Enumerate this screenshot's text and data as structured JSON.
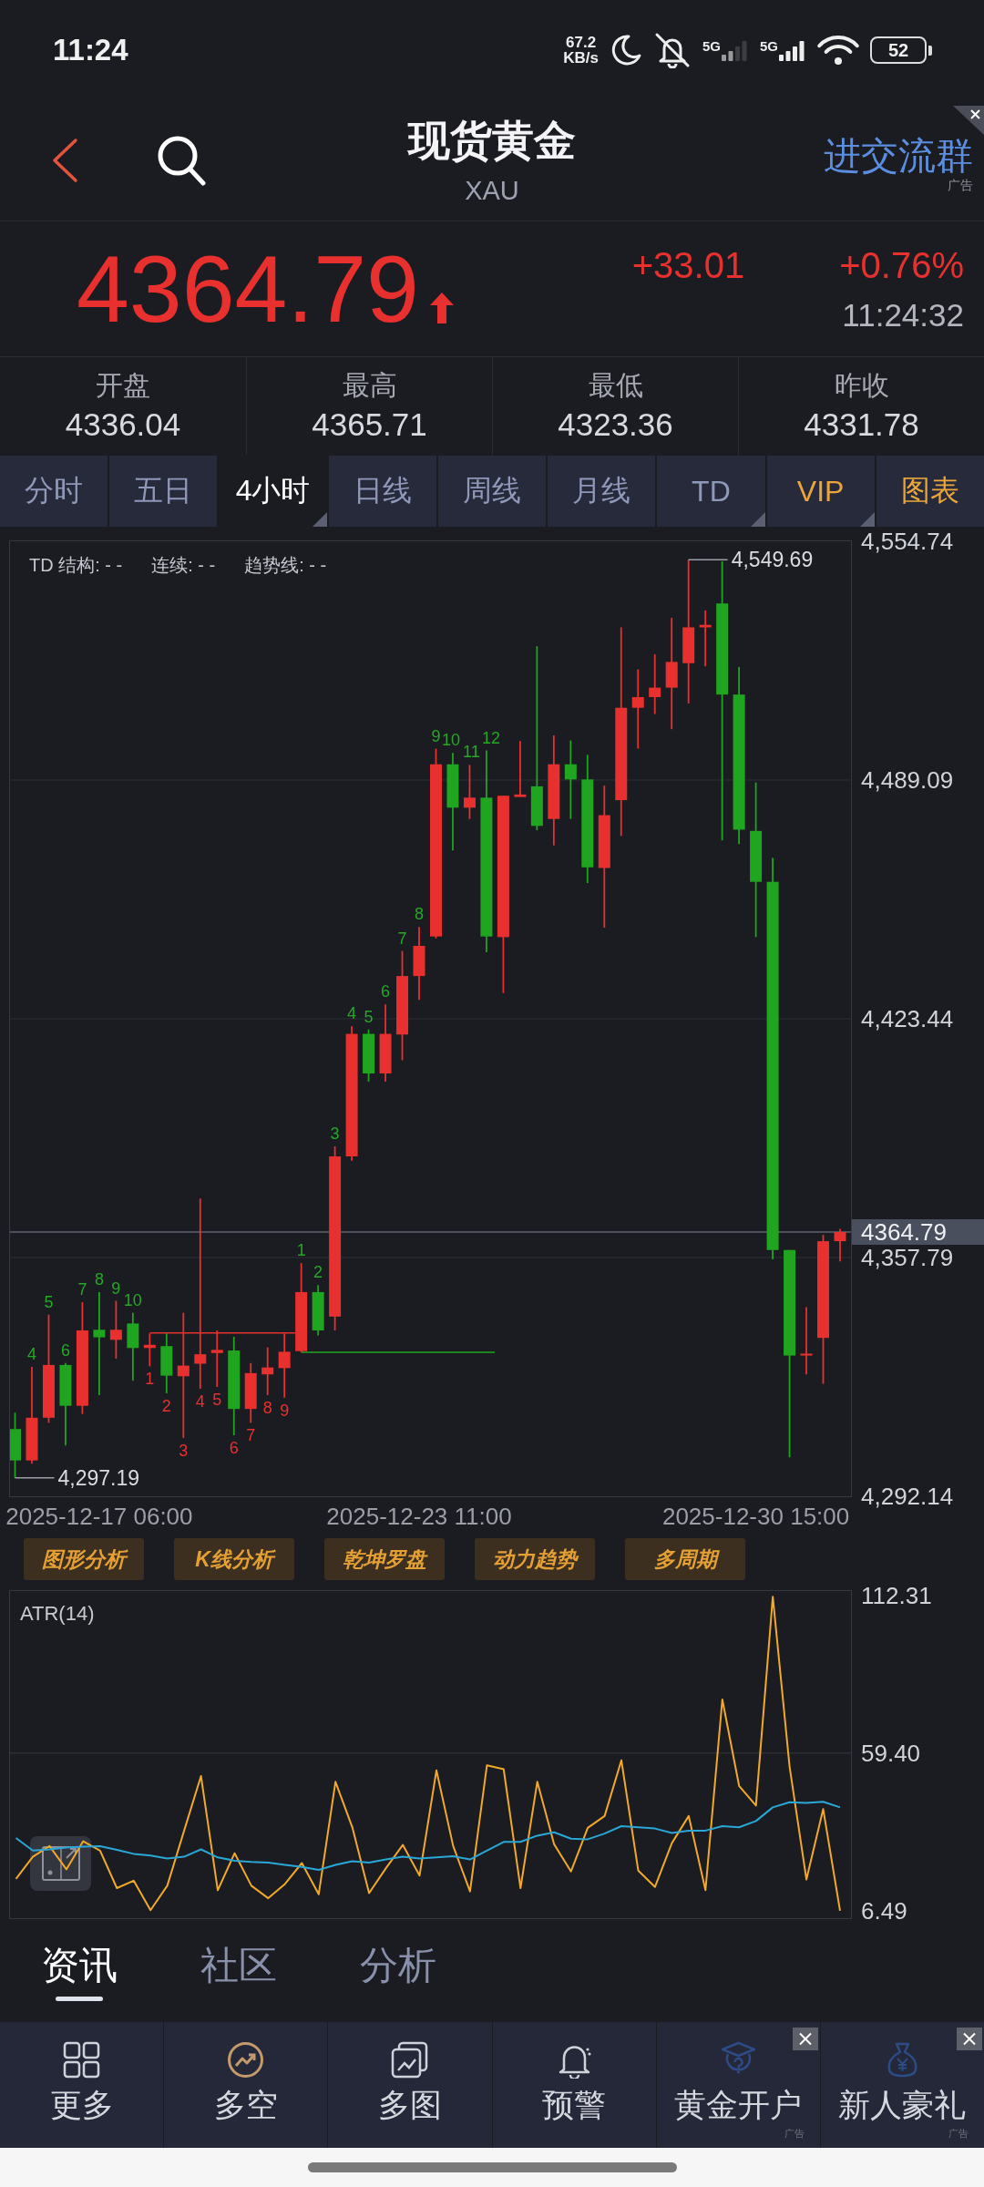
{
  "status_bar": {
    "time": "11:24",
    "net_speed": "67.2",
    "net_unit": "KB/s",
    "networks": [
      "5G",
      "5G"
    ],
    "battery": "52"
  },
  "header": {
    "title": "现货黄金",
    "symbol": "XAU",
    "ad_link": "进交流群",
    "ad_tag": "广告"
  },
  "quote": {
    "price": "4364.79",
    "up": true,
    "change": "+33.01",
    "change_percent": "+0.76%",
    "time": "11:24:32"
  },
  "stats": [
    {
      "label": "开盘",
      "value": "4336.04"
    },
    {
      "label": "最高",
      "value": "4365.71"
    },
    {
      "label": "最低",
      "value": "4323.36"
    },
    {
      "label": "昨收",
      "value": "4331.78"
    }
  ],
  "period_tabs": [
    {
      "label": "分时",
      "selected": false,
      "kind": "standard",
      "has_menu": false
    },
    {
      "label": "五日",
      "selected": false,
      "kind": "standard",
      "has_menu": false
    },
    {
      "label": "4小时",
      "selected": true,
      "kind": "standard",
      "has_menu": true
    },
    {
      "label": "日线",
      "selected": false,
      "kind": "standard",
      "has_menu": false
    },
    {
      "label": "周线",
      "selected": false,
      "kind": "standard",
      "has_menu": false
    },
    {
      "label": "月线",
      "selected": false,
      "kind": "standard",
      "has_menu": false
    },
    {
      "label": "TD",
      "selected": false,
      "kind": "standard",
      "has_menu": true
    },
    {
      "label": "VIP",
      "selected": false,
      "kind": "accent",
      "has_menu": true
    },
    {
      "label": "图表",
      "selected": false,
      "kind": "accent",
      "has_menu": false
    }
  ],
  "price_chart": {
    "legend": [
      "TD 结构: - -",
      "连续: - -",
      "趋势线: - -"
    ],
    "td_counts": [
      {
        "text": "4",
        "color": "#26a826"
      },
      {
        "text": "5",
        "color": "#26a826"
      },
      {
        "text": "6",
        "color": "#26a826"
      },
      {
        "text": "7",
        "color": "#26a826"
      },
      {
        "text": "8",
        "color": "#26a826"
      },
      {
        "text": "9",
        "color": "#26a826"
      },
      {
        "text": "10",
        "color": "#26a826"
      },
      {
        "text": "1",
        "color": "#e8302f"
      },
      {
        "text": "2",
        "color": "#e8302f"
      },
      {
        "text": "3",
        "color": "#e8302f"
      },
      {
        "text": "4",
        "color": "#e8302f"
      },
      {
        "text": "5",
        "color": "#e8302f"
      },
      {
        "text": "6",
        "color": "#e8302f"
      },
      {
        "text": "7",
        "color": "#e8302f"
      },
      {
        "text": "8",
        "color": "#e8302f"
      },
      {
        "text": "9",
        "color": "#e8302f"
      },
      {
        "text": "1",
        "color": "#26a826"
      },
      {
        "text": "2",
        "color": "#26a826"
      },
      {
        "text": "3",
        "color": "#26a826"
      },
      {
        "text": "4",
        "color": "#26a826"
      },
      {
        "text": "5",
        "color": "#26a826"
      },
      {
        "text": "6",
        "color": "#26a826"
      },
      {
        "text": "7",
        "color": "#26a826"
      },
      {
        "text": "8",
        "color": "#26a826"
      },
      {
        "text": "9",
        "color": "#26a826"
      },
      {
        "text": "10",
        "color": "#26a826"
      },
      {
        "text": "11",
        "color": "#26a826"
      },
      {
        "text": "12",
        "color": "#26a826"
      }
    ],
    "chart_data": {
      "type": "candlestick",
      "categories": [
        null,
        null,
        null,
        null,
        null,
        "2025-12-17 06:00",
        null,
        null,
        null,
        null,
        null,
        null,
        null,
        null,
        null,
        null,
        null,
        null,
        null,
        null,
        null,
        null,
        null,
        null,
        "2025-12-23 11:00",
        null,
        null,
        null,
        null,
        null,
        null,
        null,
        null,
        null,
        null,
        null,
        null,
        null,
        null,
        null,
        null,
        null,
        null,
        null,
        "2025-12-30 15:00",
        null,
        null,
        null,
        null,
        null
      ],
      "ohlc": [
        [
          4310.63,
          4315.12,
          4297.19,
          4301.99
        ],
        [
          4301.99,
          4327.73,
          4301.12,
          4313.74
        ],
        [
          4313.74,
          4342.07,
          4312.35,
          4328.25
        ],
        [
          4328.25,
          4328.77,
          4306.13,
          4317.02
        ],
        [
          4317.02,
          4345.52,
          4314.77,
          4337.75
        ],
        [
          4337.92,
          4348.29,
          4319.96,
          4335.85
        ],
        [
          4335.16,
          4345.87,
          4329.98,
          4337.92
        ],
        [
          4339.65,
          4342.59,
          4323.93,
          4332.91
        ],
        [
          4332.91,
          4336.89,
          4327.9,
          4333.78
        ],
        [
          4333.43,
          4336.89,
          4320.47,
          4325.31
        ],
        [
          4325.14,
          4342.59,
          4308.21,
          4328.07
        ],
        [
          4328.59,
          4374.03,
          4321.68,
          4331.18
        ],
        [
          4331.53,
          4337.75,
          4322.2,
          4332.39
        ],
        [
          4332.22,
          4336.02,
          4308.9,
          4316.15
        ],
        [
          4316.15,
          4328.77,
          4312.35,
          4326.0
        ],
        [
          4325.66,
          4333.08,
          4319.96,
          4327.56
        ],
        [
          4327.38,
          4336.89,
          4319.26,
          4331.88
        ],
        [
          4332.05,
          4356.24,
          4331.7,
          4348.29
        ],
        [
          4348.29,
          4350.19,
          4336.37,
          4337.75
        ],
        [
          4341.55,
          4388.37,
          4337.75,
          4385.6
        ],
        [
          4385.6,
          4421.37,
          4384.4,
          4419.29
        ],
        [
          4419.29,
          4420.5,
          4406.16,
          4408.41
        ],
        [
          4408.41,
          4427.41,
          4406.16,
          4419.29
        ],
        [
          4419.12,
          4442.1,
          4412.04,
          4435.19
        ],
        [
          4435.19,
          4448.66,
          4428.62,
          4443.48
        ],
        [
          4446.07,
          4497.73,
          4445.55,
          4493.41
        ],
        [
          4493.41,
          4496.52,
          4469.74,
          4481.49
        ],
        [
          4481.49,
          4493.24,
          4478.38,
          4484.25
        ],
        [
          4484.25,
          4497.21,
          4441.75,
          4446.07
        ],
        [
          4445.9,
          4484.77,
          4430.52,
          4484.77
        ],
        [
          4484.43,
          4499.8,
          4484.43,
          4485.12
        ],
        [
          4487.36,
          4525.89,
          4475.27,
          4476.48
        ],
        [
          4478.38,
          4501.36,
          4471.12,
          4493.41
        ],
        [
          4493.41,
          4499.97,
          4478.38,
          4489.26
        ],
        [
          4489.26,
          4496.0,
          4460.76,
          4465.08
        ],
        [
          4464.9,
          4487.54,
          4448.49,
          4479.42
        ],
        [
          4483.56,
          4531.07,
          4473.71,
          4508.96
        ],
        [
          4508.96,
          4519.5,
          4497.73,
          4511.89
        ],
        [
          4511.89,
          4523.64,
          4507.23,
          4514.49
        ],
        [
          4514.49,
          4533.66,
          4503.08,
          4521.57
        ],
        [
          4521.22,
          4549.69,
          4510.17,
          4531.07
        ],
        [
          4531.07,
          4535.74,
          4520.36,
          4531.76
        ],
        [
          4537.64,
          4549.21,
          4472.5,
          4512.59
        ],
        [
          4512.59,
          4520.19,
          4471.47,
          4475.44
        ],
        [
          4475.1,
          4488.4,
          4445.9,
          4461.1
        ],
        [
          4461.1,
          4467.67,
          4357.27,
          4359.86
        ],
        [
          4359.86,
          4359.86,
          4302.85,
          4330.84
        ],
        [
          4330.84,
          4344.14,
          4325.66,
          4331.36
        ],
        [
          4335.68,
          4364.01,
          4323.06,
          4362.28
        ],
        [
          4362.28,
          4365.71,
          4356.75,
          4364.79
        ]
      ],
      "ylim": [
        4292.14,
        4554.74
      ],
      "yticks": [
        {
          "value": 4554.74,
          "label": "4,554.74"
        },
        {
          "value": 4489.09,
          "label": "4,489.09"
        },
        {
          "value": 4423.44,
          "label": "4,423.44"
        },
        {
          "value": 4357.79,
          "label": "4,357.79"
        },
        {
          "value": 4292.14,
          "label": "4,292.14"
        }
      ],
      "grid": true,
      "ref_lines": [
        {
          "axis": "y",
          "value": 4364.79,
          "label": "4364.79",
          "color": "#5d6272"
        },
        {
          "axis": "y",
          "value": 4337.06,
          "color": "#e8302f"
        },
        {
          "axis": "y",
          "value": 4331.7,
          "color": "#1fa51f"
        }
      ],
      "annotations": [
        "4,549.69",
        "4,297.19"
      ]
    }
  },
  "analysis_tools": [
    "图形分析",
    "K线分析",
    "乾坤罗盘",
    "动力趋势",
    "多周期"
  ],
  "indicator_chart": {
    "chart_data": {
      "type": "line",
      "title": "ATR(14)",
      "ylim": [
        4.0,
        113.8
      ],
      "yticks": [
        {
          "value": 112.31,
          "label": "112.31"
        },
        {
          "value": 59.4,
          "label": "59.40"
        },
        {
          "value": 6.49,
          "label": "6.49"
        }
      ],
      "grid": true,
      "series": [
        {
          "color": "#f0a92a",
          "values": [
            17.2,
            24.6,
            28.2,
            20.4,
            29.8,
            26.7,
            14.1,
            16.6,
            6.7,
            14.9,
            33.4,
            51.7,
            13.4,
            25.8,
            14.9,
            10.7,
            15.5,
            22.5,
            12.0,
            49.8,
            34.5,
            12.4,
            20.8,
            28.6,
            18.3,
            53.6,
            28.2,
            13.0,
            55.3,
            54.0,
            14.1,
            49.8,
            28.8,
            19.7,
            34.3,
            38.3,
            57.0,
            20.0,
            14.5,
            29.2,
            38.3,
            13.4,
            77.4,
            48.4,
            41.8,
            111.9,
            54.9,
            17.0,
            40.6,
            6.5
          ]
        },
        {
          "color": "#2aa7d6",
          "values": [
            30.9,
            26.7,
            27.1,
            27.7,
            28.0,
            28.2,
            26.9,
            25.6,
            25.0,
            24.0,
            24.6,
            27.1,
            24.4,
            23.3,
            22.9,
            22.7,
            21.9,
            21.2,
            20.2,
            21.9,
            23.1,
            22.7,
            23.7,
            24.6,
            24.0,
            24.4,
            24.8,
            23.7,
            26.7,
            29.6,
            29.6,
            31.7,
            32.8,
            30.7,
            30.5,
            32.4,
            34.9,
            34.5,
            34.1,
            32.6,
            33.4,
            33.4,
            34.9,
            34.5,
            36.6,
            41.2,
            42.9,
            42.7,
            43.1,
            41.2
          ]
        }
      ]
    }
  },
  "content_tabs": [
    {
      "label": "资讯",
      "selected": true
    },
    {
      "label": "社区",
      "selected": false
    },
    {
      "label": "分析",
      "selected": false
    }
  ],
  "toolbar": [
    {
      "label": "更多",
      "kind": "grid",
      "closable": false
    },
    {
      "label": "多空",
      "kind": "trend",
      "closable": false
    },
    {
      "label": "多图",
      "kind": "charts",
      "closable": false
    },
    {
      "label": "预警",
      "kind": "alert",
      "closable": false
    },
    {
      "label": "黄金开户",
      "kind": "account",
      "tag": "广告",
      "closable": true
    },
    {
      "label": "新人豪礼",
      "kind": "gift",
      "tag": "广告",
      "closable": true
    }
  ]
}
